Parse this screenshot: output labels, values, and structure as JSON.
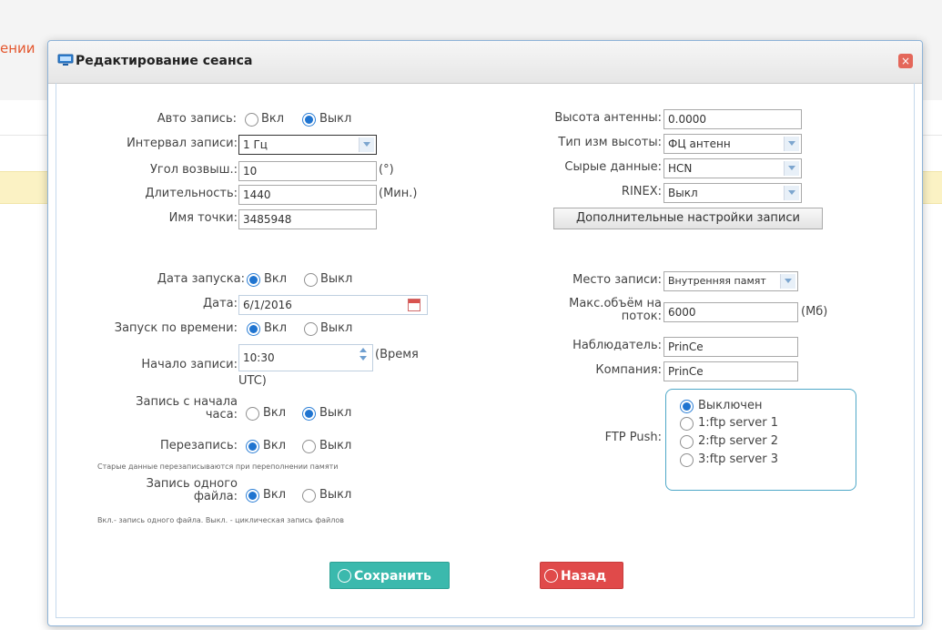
{
  "background": {
    "crumb_text": "ении"
  },
  "dialog": {
    "title": "Редактирование сеанса",
    "close_label": "×"
  },
  "left": {
    "auto_record": {
      "label": "Авто запись:",
      "on": "Вкл",
      "off": "Выкл",
      "selected": "off"
    },
    "interval": {
      "label": "Интервал записи:",
      "value": "1 Гц"
    },
    "elevation": {
      "label": "Угол возвыш.:",
      "value": "10",
      "unit": "(°)"
    },
    "duration": {
      "label": "Длительность:",
      "value": "1440",
      "unit": "(Мин.)"
    },
    "point_name": {
      "label": "Имя точки:",
      "value": "3485948"
    },
    "start_date": {
      "label": "Дата запуска:",
      "on": "Вкл",
      "off": "Выкл",
      "selected": "on"
    },
    "date": {
      "label": "Дата:",
      "value": "6/1/2016"
    },
    "time_start": {
      "label": "Запуск по времени:",
      "on": "Вкл",
      "off": "Выкл",
      "selected": "on"
    },
    "record_start": {
      "label": "Начало записи:",
      "value": "10:30",
      "unit_1": "(Время",
      "unit_2": "UTC)"
    },
    "hour_start": {
      "label_1": "Запись с начала",
      "label_2": "часа:",
      "on": "Вкл",
      "off": "Выкл",
      "selected": "off"
    },
    "overwrite": {
      "label": "Перезапись:",
      "on": "Вкл",
      "off": "Выкл",
      "selected": "on",
      "note": "Старые данные перезаписываются при переполнении памяти"
    },
    "single_file": {
      "label_1": "Запись одного",
      "label_2": "файла:",
      "on": "Вкл",
      "off": "Выкл",
      "selected": "on",
      "note": "Вкл.- запись одного файла. Выкл. - циклическая запись файлов"
    }
  },
  "right": {
    "antenna_height": {
      "label": "Высота антенны:",
      "value": "0.0000"
    },
    "height_type": {
      "label": "Тип изм высоты:",
      "value": "ФЦ антенн"
    },
    "raw_data": {
      "label": "Сырые данные:",
      "value": "HCN"
    },
    "rinex": {
      "label": "RINEX:",
      "value": "Выкл"
    },
    "more_settings": "Дополнительные настройки записи",
    "storage": {
      "label": "Место записи:",
      "value": "Внутренняя памят"
    },
    "max_size": {
      "label_1": "Макс.объём на",
      "label_2": "поток:",
      "value": "6000",
      "unit": "(Мб)"
    },
    "observer": {
      "label": "Наблюдатель:",
      "value": "PrinCe"
    },
    "company": {
      "label": "Компания:",
      "value": "PrinCe"
    },
    "ftp": {
      "label": "FTP Push:",
      "options": [
        "Выключен",
        "1:ftp server 1",
        "2:ftp server 2",
        "3:ftp server 3"
      ],
      "selected_index": 0
    }
  },
  "buttons": {
    "save": "Сохранить",
    "back": "Назад"
  },
  "colors": {
    "save": "#3bb9ad",
    "back": "#e04a4a",
    "accent": "#1f74d0"
  }
}
